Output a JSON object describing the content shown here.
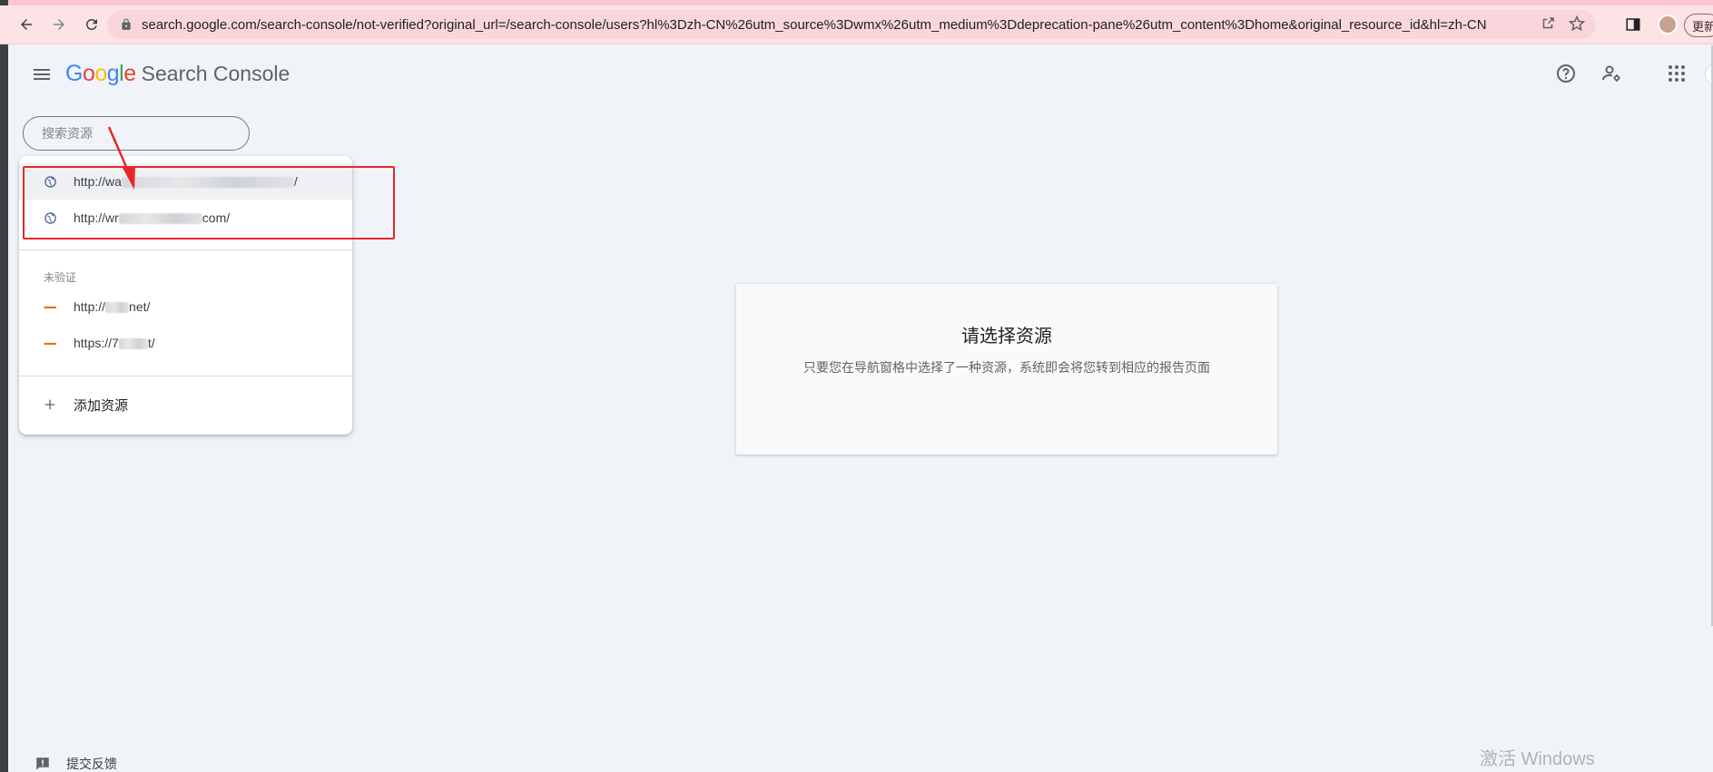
{
  "browser": {
    "url": "search.google.com/search-console/not-verified?original_url=/search-console/users?hl%3Dzh-CN%26utm_source%3Dwmx%26utm_medium%3Ddeprecation-pane%26utm_content%3Dhome&original_resource_id&hl=zh-CN",
    "update_label": "更新"
  },
  "header": {
    "logo_google": [
      "G",
      "o",
      "o",
      "g",
      "l",
      "e"
    ],
    "logo_colors": [
      "#4285f4",
      "#ea4335",
      "#fbbc05",
      "#4285f4",
      "#34a853",
      "#ea4335"
    ],
    "product": "Search Console"
  },
  "search": {
    "placeholder": "搜索资源"
  },
  "dropdown": {
    "verified": [
      {
        "prefix": "http://wa",
        "suffix": "/",
        "icon": "globe-icon"
      },
      {
        "prefix": "http://wr",
        "suffix": "com/",
        "icon": "globe-icon"
      }
    ],
    "unverified_label": "未验证",
    "unverified": [
      {
        "prefix": "http://",
        "suffix": "net/",
        "icon": "brand-icon"
      },
      {
        "prefix": "https://7",
        "suffix": "t/",
        "icon": "brand-icon"
      }
    ],
    "add_label": "添加资源"
  },
  "card": {
    "title": "请选择资源",
    "body": "只要您在导航窗格中选择了一种资源，系统即会将您转到相应的报告页面"
  },
  "footer": {
    "feedback": "提交反馈",
    "watermark": "激活 Windows"
  }
}
